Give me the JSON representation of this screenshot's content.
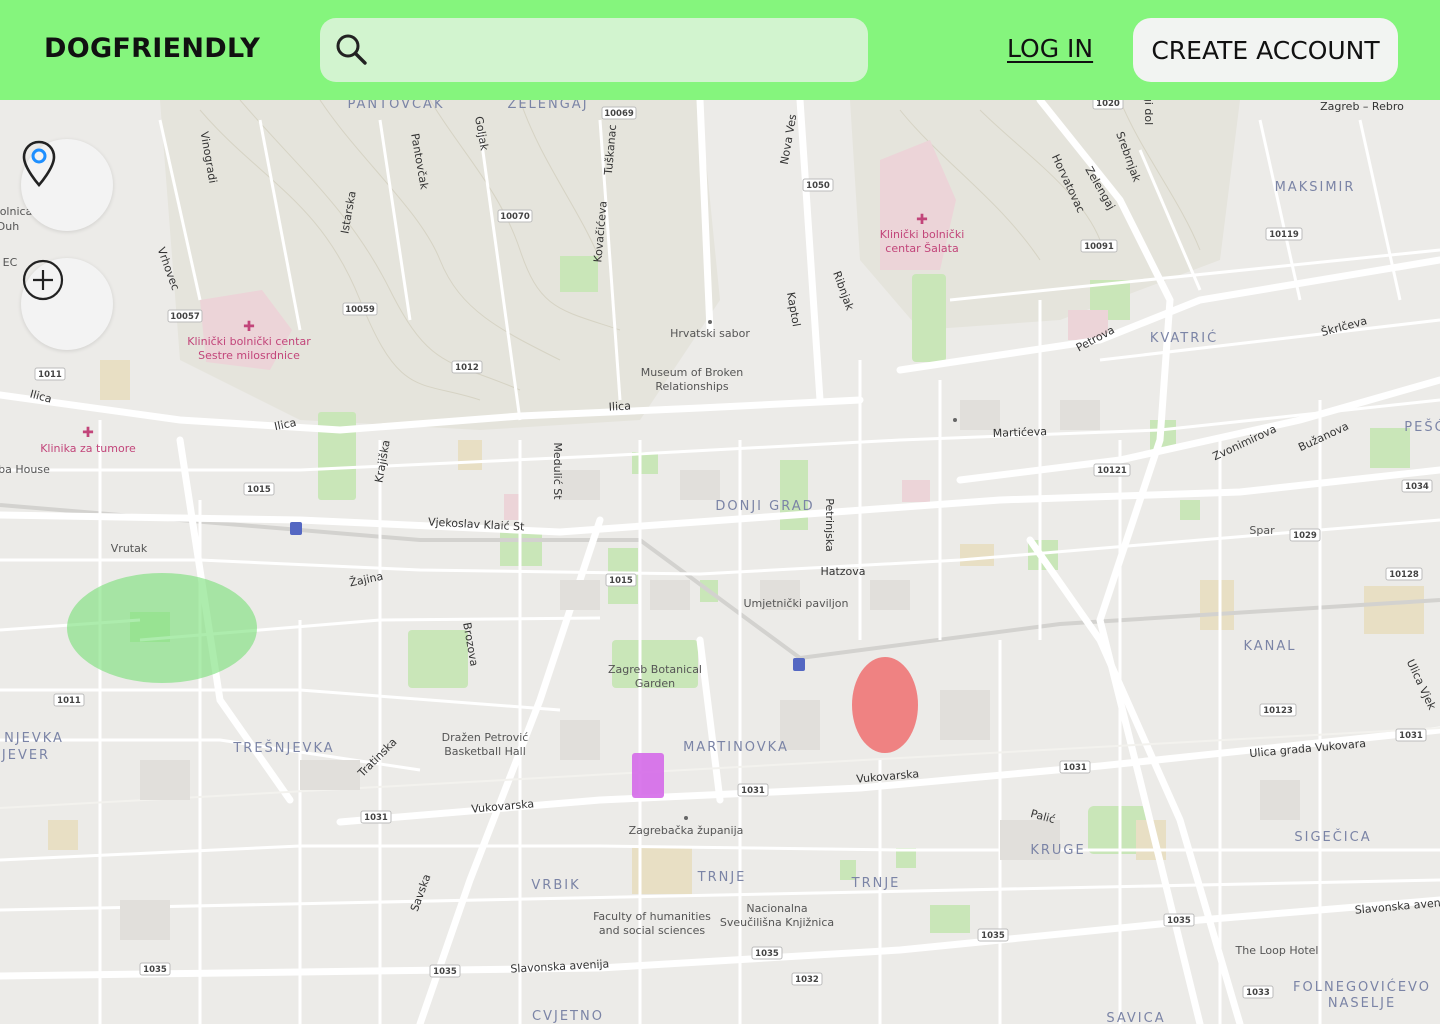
{
  "header": {
    "logo": "DOGFRIENDLY",
    "search_placeholder": "",
    "login_label": "LOG IN",
    "create_account_label": "CREATE ACCOUNT"
  },
  "controls": {
    "location_icon": "map-pin-icon",
    "zoom_icon": "plus-circle-icon"
  },
  "colors": {
    "header_bg": "#85f57d",
    "search_bg": "#d2f4cf",
    "marker_green": "#7be07a",
    "marker_red": "#f07070",
    "marker_purple": "#d466e8"
  },
  "map": {
    "districts": [
      "PANTOVČAK",
      "ZELENGAJ",
      "MAKSIMIR",
      "KVATRIĆ",
      "PEŠĆ",
      "DONJI GRAD",
      "KANAL",
      "MARTINOVKA",
      "TREŠNJEVKA",
      "NJEVKA",
      "JEVER",
      "TRNJE",
      "TRNJE",
      "VRBIK",
      "KRUGE",
      "SIGEČICA",
      "CVJETNO",
      "SAVICA",
      "FOLNEGOVIĆEVO",
      "NASELJE"
    ],
    "streets": [
      "Ilica",
      "Ilica",
      "Ilica",
      "Vjekoslav Klaić St",
      "Žajina",
      "Vukovarska",
      "Vukovarska",
      "Ulica grada Vukovara",
      "Slavonska avenija",
      "Slavonska aven",
      "Savska",
      "Tratinska",
      "Petrova",
      "Martićeva",
      "Zvonimirova",
      "Hatzova",
      "Petrinjska",
      "Kaptol",
      "Ribnjak",
      "Nova Ves",
      "Pantovčak",
      "Tuškanac",
      "Kovačićeva",
      "Goljak",
      "Istarska",
      "Vinogradi",
      "Vrhovec",
      "Krajiška",
      "Medulić St",
      "Brozova",
      "Horvatovac",
      "Srebrnjak",
      "Zelengaj",
      "Škrlčeva",
      "Bužanova",
      "Palić",
      "Ulica Vjek",
      "Zagreb – Rebro",
      "gi dol"
    ],
    "pois": [
      "Klinički bolnički centar Šalata",
      "Klinički bolnički centar Sestre milosrdnice",
      "Hrvatski sabor",
      "Museum of Broken Relationships",
      "Klinika za tumore",
      "ba House",
      "Vrutak",
      "Zagreb Botanical Garden",
      "Umjetnički paviljon",
      "Dražen Petrović Basketball Hall",
      "Zagrebačka županija",
      "Faculty of humanities and social sciences",
      "Nacionalna Sveučilišna Knjižnica",
      "Spar",
      "The Loop Hotel",
      "olnica",
      "Duh",
      "EC"
    ],
    "road_numbers": [
      "10069",
      "10070",
      "10059",
      "10057",
      "1011",
      "1012",
      "1050",
      "10091",
      "10119",
      "1020",
      "1015",
      "1015",
      "10121",
      "1034",
      "1029",
      "10128",
      "10123",
      "1031",
      "1031",
      "1031",
      "1031",
      "1011",
      "1035",
      "1035",
      "1035",
      "1035",
      "1035",
      "1032",
      "1033"
    ],
    "markers": [
      {
        "name": "green-area-marker",
        "color": "#7be07a"
      },
      {
        "name": "red-area-marker",
        "color": "#f07070"
      },
      {
        "name": "purple-area-marker",
        "color": "#d466e8"
      }
    ]
  }
}
